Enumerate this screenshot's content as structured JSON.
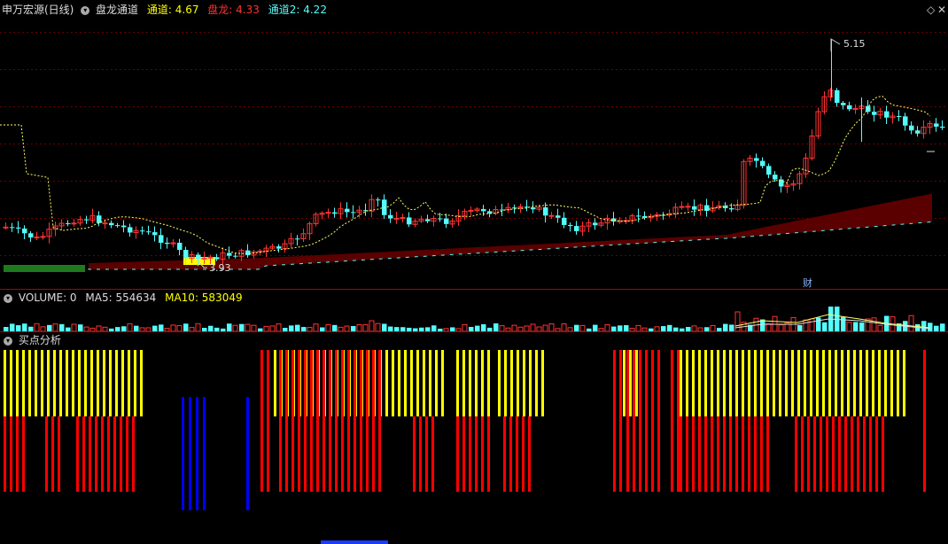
{
  "header": {
    "stock": "申万宏源(日线)",
    "indicator": "盘龙通道",
    "ch_label": "通道:",
    "ch_value": "4.67",
    "pl_label": "盘龙:",
    "pl_value": "4.33",
    "ch2_label": "通道2:",
    "ch2_value": "4.22"
  },
  "window": {
    "restore_icon": "diamond-icon",
    "close_icon": "x-icon"
  },
  "price_panel": {
    "high_label": "5.15",
    "low_label": "3.93",
    "fin_marker": "财"
  },
  "volume_panel": {
    "vol_label": "VOLUME: 0",
    "ma5_label": "MA5: 554634",
    "ma10_label": "MA10: 583049"
  },
  "signal_panel": {
    "title": "买点分析"
  },
  "colors": {
    "bg": "#000000",
    "up": "#ff3232",
    "down": "#54fcfc",
    "yellow": "#ffff00",
    "red": "#ff0000",
    "blue": "#0000ff",
    "channel_fill": "#5a0000",
    "separator": "#b00000"
  }
}
